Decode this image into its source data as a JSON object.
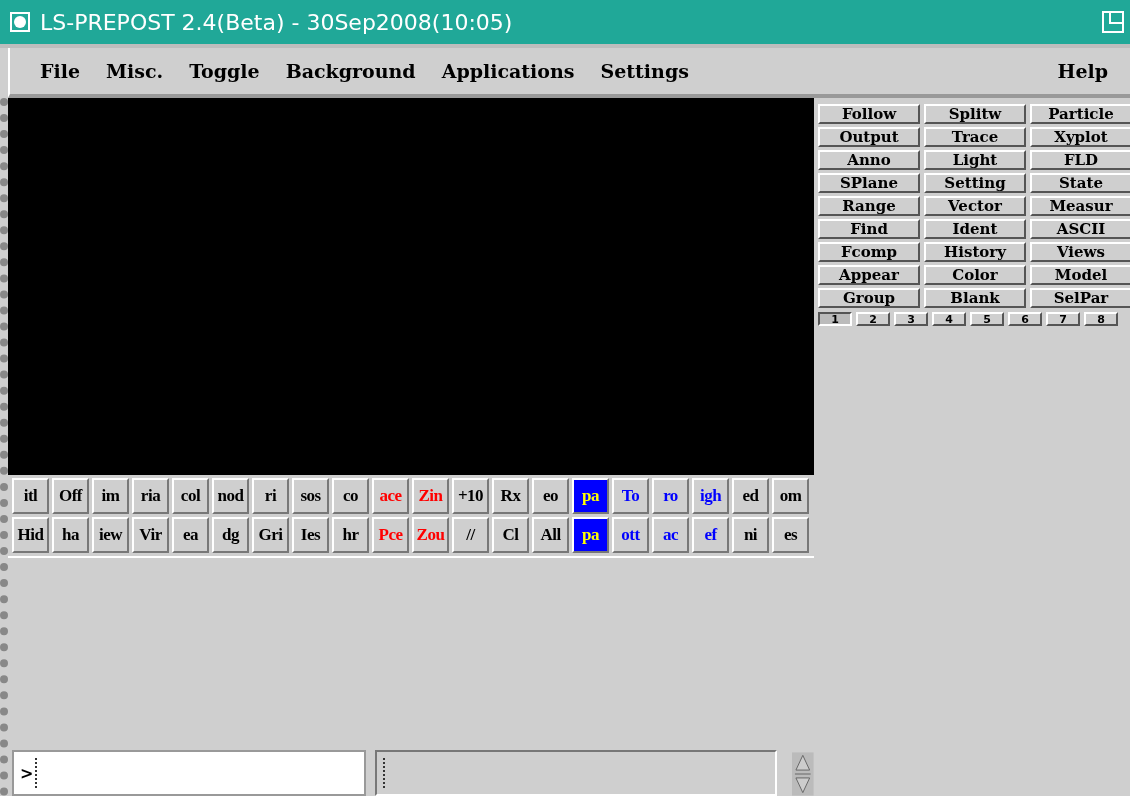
{
  "window": {
    "title": "LS-PREPOST 2.4(Beta) - 30Sep2008(10:05)"
  },
  "menu": [
    "File",
    "Misc.",
    "Toggle",
    "Background",
    "Applications",
    "Settings"
  ],
  "help_menu": "Help",
  "panel_buttons": [
    "Follow",
    "Splitw",
    "Particle",
    "Output",
    "Trace",
    "Xyplot",
    "Anno",
    "Light",
    "FLD",
    "SPlane",
    "Setting",
    "State",
    "Range",
    "Vector",
    "Measur",
    "Find",
    "Ident",
    "ASCII",
    "Fcomp",
    "History",
    "Views",
    "Appear",
    "Color",
    "Model",
    "Group",
    "Blank",
    "SelPar"
  ],
  "page_tabs": [
    {
      "label": "1",
      "selected": true
    },
    {
      "label": "2",
      "selected": false
    },
    {
      "label": "3",
      "selected": false
    },
    {
      "label": "4",
      "selected": false
    },
    {
      "label": "5",
      "selected": false
    },
    {
      "label": "6",
      "selected": false
    },
    {
      "label": "7",
      "selected": false
    },
    {
      "label": "8",
      "selected": false
    }
  ],
  "toolbar_rows": [
    [
      {
        "label": "itl",
        "color": "#000000",
        "highlighted": false
      },
      {
        "label": "Off",
        "color": "#000000",
        "highlighted": false
      },
      {
        "label": "im",
        "color": "#000000",
        "highlighted": false
      },
      {
        "label": "ria",
        "color": "#000000",
        "highlighted": false
      },
      {
        "label": "col",
        "color": "#000000",
        "highlighted": false
      },
      {
        "label": "nod",
        "color": "#000000",
        "highlighted": false
      },
      {
        "label": "ri",
        "color": "#000000",
        "highlighted": false
      },
      {
        "label": "sos",
        "color": "#000000",
        "highlighted": false
      },
      {
        "label": "co",
        "color": "#000000",
        "highlighted": false
      },
      {
        "label": "ace",
        "color": "#ff0000",
        "highlighted": false
      },
      {
        "label": "Zin",
        "color": "#ff0000",
        "highlighted": false
      },
      {
        "label": "+10",
        "color": "#000000",
        "highlighted": false
      },
      {
        "label": "Rx",
        "color": "#000000",
        "highlighted": false
      },
      {
        "label": "eo",
        "color": "#000000",
        "highlighted": false
      },
      {
        "label": "pa",
        "highlighted": true
      },
      {
        "label": "To",
        "color": "#0000ff",
        "highlighted": false
      },
      {
        "label": "ro",
        "color": "#0000ff",
        "highlighted": false
      },
      {
        "label": "igh",
        "color": "#0000ff",
        "highlighted": false
      },
      {
        "label": "ed",
        "color": "#000000",
        "highlighted": false
      },
      {
        "label": "om",
        "color": "#000000",
        "highlighted": false
      }
    ],
    [
      {
        "label": "Hid",
        "color": "#000000",
        "highlighted": false
      },
      {
        "label": "ha",
        "color": "#000000",
        "highlighted": false
      },
      {
        "label": "iew",
        "color": "#000000",
        "highlighted": false
      },
      {
        "label": "Vir",
        "color": "#000000",
        "highlighted": false
      },
      {
        "label": "ea",
        "color": "#000000",
        "highlighted": false
      },
      {
        "label": "dg",
        "color": "#000000",
        "highlighted": false
      },
      {
        "label": "Gri",
        "color": "#000000",
        "highlighted": false
      },
      {
        "label": "Ies",
        "color": "#000000",
        "highlighted": false
      },
      {
        "label": "hr",
        "color": "#000000",
        "highlighted": false
      },
      {
        "label": "Pce",
        "color": "#ff0000",
        "highlighted": false
      },
      {
        "label": "Zou",
        "color": "#ff0000",
        "highlighted": false
      },
      {
        "label": "//",
        "color": "#000000",
        "highlighted": false
      },
      {
        "label": "Cl",
        "color": "#000000",
        "highlighted": false
      },
      {
        "label": "All",
        "color": "#000000",
        "highlighted": false
      },
      {
        "label": "pa",
        "highlighted": true
      },
      {
        "label": "ott",
        "color": "#0000ff",
        "highlighted": false
      },
      {
        "label": "ac",
        "color": "#0000ff",
        "highlighted": false
      },
      {
        "label": "ef",
        "color": "#0000ff",
        "highlighted": false
      },
      {
        "label": "ni",
        "color": "#000000",
        "highlighted": false
      },
      {
        "label": "es",
        "color": "#000000",
        "highlighted": false
      }
    ]
  ],
  "command_field": {
    "value": ">"
  }
}
